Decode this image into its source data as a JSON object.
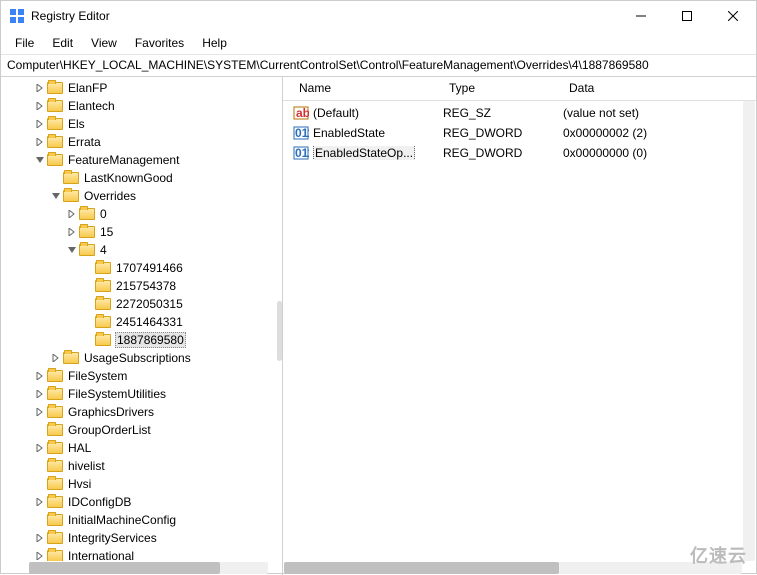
{
  "window": {
    "title": "Registry Editor"
  },
  "menu": {
    "file": "File",
    "edit": "Edit",
    "view": "View",
    "favorites": "Favorites",
    "help": "Help"
  },
  "path": "Computer\\HKEY_LOCAL_MACHINE\\SYSTEM\\CurrentControlSet\\Control\\FeatureManagement\\Overrides\\4\\1887869580",
  "columns": {
    "name": "Name",
    "type": "Type",
    "data": "Data"
  },
  "values": [
    {
      "icon": "string",
      "name": "(Default)",
      "type": "REG_SZ",
      "data": "(value not set)",
      "selected": false
    },
    {
      "icon": "binary",
      "name": "EnabledState",
      "type": "REG_DWORD",
      "data": "0x00000002 (2)",
      "selected": false
    },
    {
      "icon": "binary",
      "name": "EnabledStateOp...",
      "type": "REG_DWORD",
      "data": "0x00000000 (0)",
      "selected": true
    }
  ],
  "tree": [
    {
      "indent": 2,
      "exp": "closed",
      "label": "ElanFP"
    },
    {
      "indent": 2,
      "exp": "closed",
      "label": "Elantech"
    },
    {
      "indent": 2,
      "exp": "closed",
      "label": "Els"
    },
    {
      "indent": 2,
      "exp": "closed",
      "label": "Errata"
    },
    {
      "indent": 2,
      "exp": "open",
      "label": "FeatureManagement"
    },
    {
      "indent": 3,
      "exp": "none",
      "label": "LastKnownGood"
    },
    {
      "indent": 3,
      "exp": "open",
      "label": "Overrides"
    },
    {
      "indent": 4,
      "exp": "closed",
      "label": "0"
    },
    {
      "indent": 4,
      "exp": "closed",
      "label": "15"
    },
    {
      "indent": 4,
      "exp": "open",
      "label": "4"
    },
    {
      "indent": 5,
      "exp": "none",
      "label": "1707491466"
    },
    {
      "indent": 5,
      "exp": "none",
      "label": "215754378"
    },
    {
      "indent": 5,
      "exp": "none",
      "label": "2272050315"
    },
    {
      "indent": 5,
      "exp": "none",
      "label": "2451464331"
    },
    {
      "indent": 5,
      "exp": "none",
      "label": "1887869580",
      "selected": true
    },
    {
      "indent": 3,
      "exp": "closed",
      "label": "UsageSubscriptions"
    },
    {
      "indent": 2,
      "exp": "closed",
      "label": "FileSystem"
    },
    {
      "indent": 2,
      "exp": "closed",
      "label": "FileSystemUtilities"
    },
    {
      "indent": 2,
      "exp": "closed",
      "label": "GraphicsDrivers"
    },
    {
      "indent": 2,
      "exp": "none",
      "label": "GroupOrderList"
    },
    {
      "indent": 2,
      "exp": "closed",
      "label": "HAL"
    },
    {
      "indent": 2,
      "exp": "none",
      "label": "hivelist"
    },
    {
      "indent": 2,
      "exp": "none",
      "label": "Hvsi"
    },
    {
      "indent": 2,
      "exp": "closed",
      "label": "IDConfigDB"
    },
    {
      "indent": 2,
      "exp": "none",
      "label": "InitialMachineConfig"
    },
    {
      "indent": 2,
      "exp": "closed",
      "label": "IntegrityServices"
    },
    {
      "indent": 2,
      "exp": "closed",
      "label": "International"
    }
  ],
  "watermark": "亿速云"
}
